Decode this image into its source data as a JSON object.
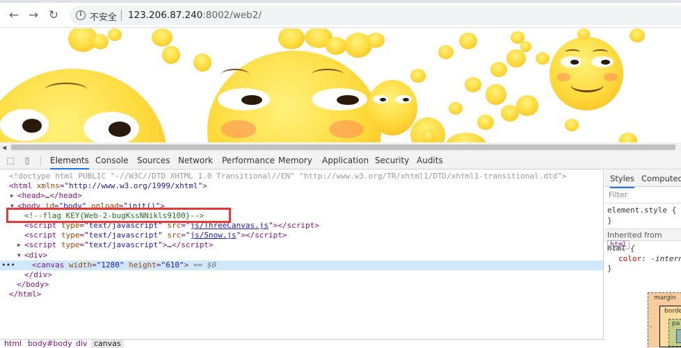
{
  "browser": {
    "insecure_label": "不安全",
    "url_host": "123.206.87.240",
    "url_rest": ":8002/web2/",
    "back_icon": "←",
    "forward_icon": "→",
    "reload_icon": "↻"
  },
  "devtools": {
    "tabs": [
      "Elements",
      "Console",
      "Sources",
      "Network",
      "Performance",
      "Memory",
      "Application",
      "Security",
      "Audits"
    ],
    "active_tab": "Elements",
    "dom": {
      "doctype": "<!doctype html PUBLIC \"-//W3C//DTD XHTML 1.0 Transitional//EN\" \"http://www.w3.org/TR/xhtml1/DTD/xhtml1-transitional.dtd\">",
      "html_xmlns": "http://www.w3.org/1999/xhtml",
      "head_collapsed": "…",
      "body_id": "body",
      "body_onload": "init()",
      "flag_comment": "<!--flag KEY{Web-2-bugKssNNikls9100}-->",
      "script1_type": "text/javascript",
      "script1_src": "js/ThreeCanvas.js",
      "script2_type": "text/javascript",
      "script2_src": "js/Snow.js",
      "script3_type": "text/javascript",
      "canvas_width": "1280",
      "canvas_height": "610",
      "selected_marker": "== $0"
    },
    "breadcrumb": [
      "html",
      "body#body",
      "div",
      "canvas"
    ],
    "styles": {
      "tabs": [
        "Styles",
        "Computed"
      ],
      "filter_placeholder": "Filter",
      "element_style": "element.style {",
      "close_brace": "}",
      "inherited_label": "Inherited from",
      "inherited_tag": "html",
      "html_rule_selector": "html {",
      "html_rule_prop": "color",
      "html_rule_value": "-interna",
      "boxmodel_margin": "margin",
      "boxmodel_border": "borde",
      "boxmodel_padding": "pa",
      "boxmodel_dash": "-"
    }
  }
}
